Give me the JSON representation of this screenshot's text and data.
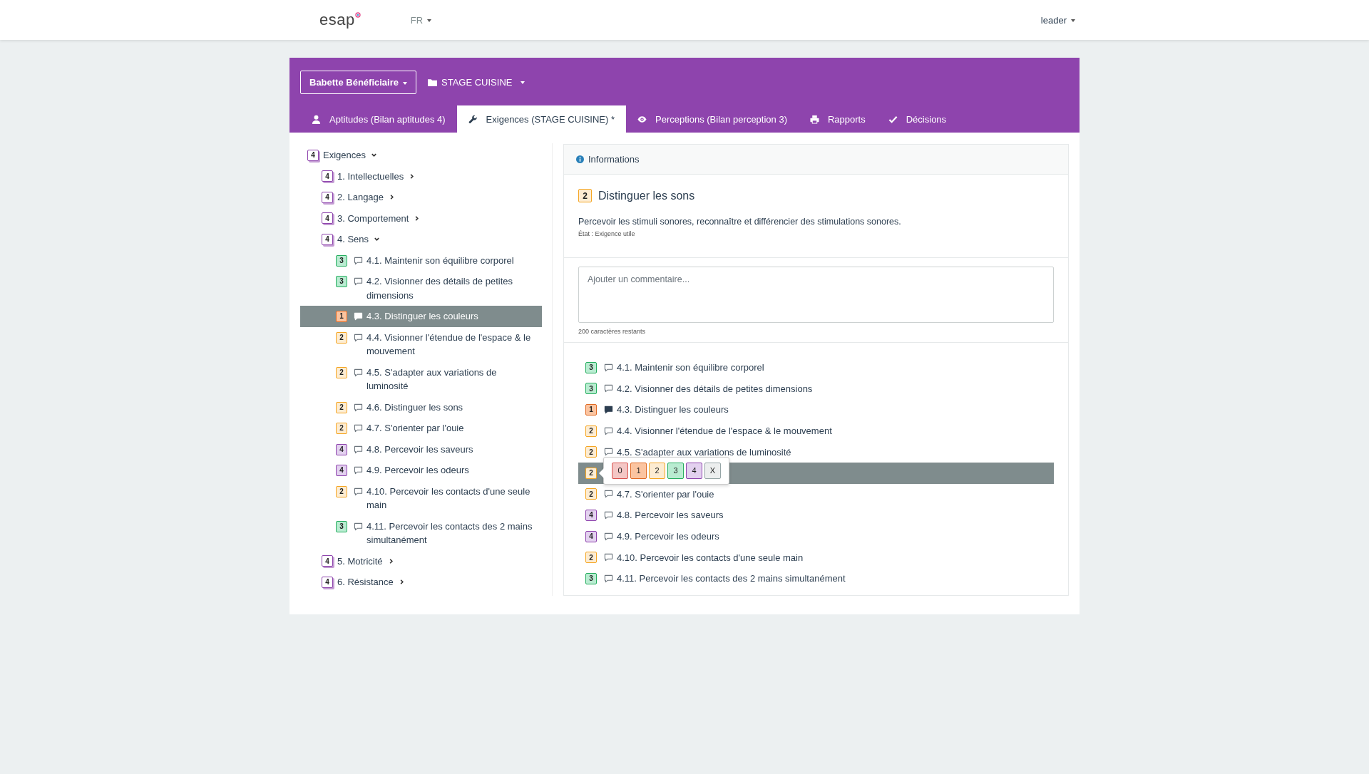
{
  "topbar": {
    "logo": "esap",
    "language": "FR",
    "user": "leader"
  },
  "header": {
    "person": "Babette Bénéficiaire",
    "folder": "STAGE CUISINE"
  },
  "tabs": [
    {
      "label": "Aptitudes (Bilan aptitudes 4)",
      "selected": false
    },
    {
      "label": "Exigences (STAGE CUISINE) *",
      "selected": true
    },
    {
      "label": "Perceptions (Bilan perception 3)",
      "selected": false
    },
    {
      "label": "Rapports",
      "selected": false
    },
    {
      "label": "Décisions",
      "selected": false
    }
  ],
  "tree": {
    "score": "4",
    "label": "Exigences",
    "expanded": true,
    "children": [
      {
        "score": "4",
        "label": "1. Intellectuelles",
        "expanded": false
      },
      {
        "score": "4",
        "label": "2. Langage",
        "expanded": false
      },
      {
        "score": "4",
        "label": "3. Comportement",
        "expanded": false
      },
      {
        "score": "4",
        "label": "4. Sens",
        "expanded": true,
        "children": [
          {
            "score": "3",
            "label": "4.1. Maintenir son équilibre corporel",
            "commented": false,
            "selected": false
          },
          {
            "score": "3",
            "label": "4.2. Visionner des détails de petites dimensions",
            "commented": false,
            "selected": false
          },
          {
            "score": "1",
            "label": "4.3. Distinguer les couleurs",
            "commented": true,
            "selected": true
          },
          {
            "score": "2",
            "label": "4.4. Visionner l'étendue de l'espace & le mouvement",
            "commented": false,
            "selected": false
          },
          {
            "score": "2",
            "label": "4.5. S'adapter aux variations de luminosité",
            "commented": false,
            "selected": false
          },
          {
            "score": "2",
            "label": "4.6. Distinguer les sons",
            "commented": false,
            "selected": false
          },
          {
            "score": "2",
            "label": "4.7. S'orienter par l'ouie",
            "commented": false,
            "selected": false
          },
          {
            "score": "4",
            "label": "4.8. Percevoir les saveurs",
            "commented": false,
            "selected": false
          },
          {
            "score": "4",
            "label": "4.9. Percevoir les odeurs",
            "commented": false,
            "selected": false
          },
          {
            "score": "2",
            "label": "4.10. Percevoir les contacts d'une seule main",
            "commented": false,
            "selected": false
          },
          {
            "score": "3",
            "label": "4.11. Percevoir les contacts des 2 mains simultanément",
            "commented": false,
            "selected": false
          }
        ]
      },
      {
        "score": "4",
        "label": "5. Motricité",
        "expanded": false
      },
      {
        "score": "4",
        "label": "6. Résistance",
        "expanded": false
      }
    ]
  },
  "info": {
    "title": "Informations",
    "score": "2",
    "heading": "Distinguer les sons",
    "description": "Percevoir les stimuli sonores, reconnaître et différencier des stimulations sonores.",
    "state": "État : Exigence utile"
  },
  "comment": {
    "placeholder": "Ajouter un commentaire...",
    "counter": "200 caractères restants"
  },
  "ratings": [
    {
      "score": "3",
      "label": "4.1. Maintenir son équilibre corporel",
      "commented": false,
      "selected": false
    },
    {
      "score": "3",
      "label": "4.2. Visionner des détails de petites dimensions",
      "commented": false,
      "selected": false
    },
    {
      "score": "1",
      "label": "4.3. Distinguer les couleurs",
      "commented": true,
      "selected": false
    },
    {
      "score": "2",
      "label": "4.4. Visionner l'étendue de l'espace & le mouvement",
      "commented": false,
      "selected": false
    },
    {
      "score": "2",
      "label": "4.5. S'adapter aux variations de luminosité",
      "commented": false,
      "selected": false
    },
    {
      "score": "2",
      "selected": true
    },
    {
      "score": "2",
      "label": "4.7. S'orienter par l'ouie",
      "commented": false,
      "selected": false
    },
    {
      "score": "4",
      "label": "4.8. Percevoir les saveurs",
      "commented": false,
      "selected": false
    },
    {
      "score": "4",
      "label": "4.9. Percevoir les odeurs",
      "commented": false,
      "selected": false
    },
    {
      "score": "2",
      "label": "4.10. Percevoir les contacts d'une seule main",
      "commented": false,
      "selected": false
    },
    {
      "score": "3",
      "label": "4.11. Percevoir les contacts des 2 mains simultanément",
      "commented": false,
      "selected": false
    }
  ],
  "score_picker": {
    "options": [
      "0",
      "1",
      "2",
      "3",
      "4",
      "X"
    ]
  }
}
